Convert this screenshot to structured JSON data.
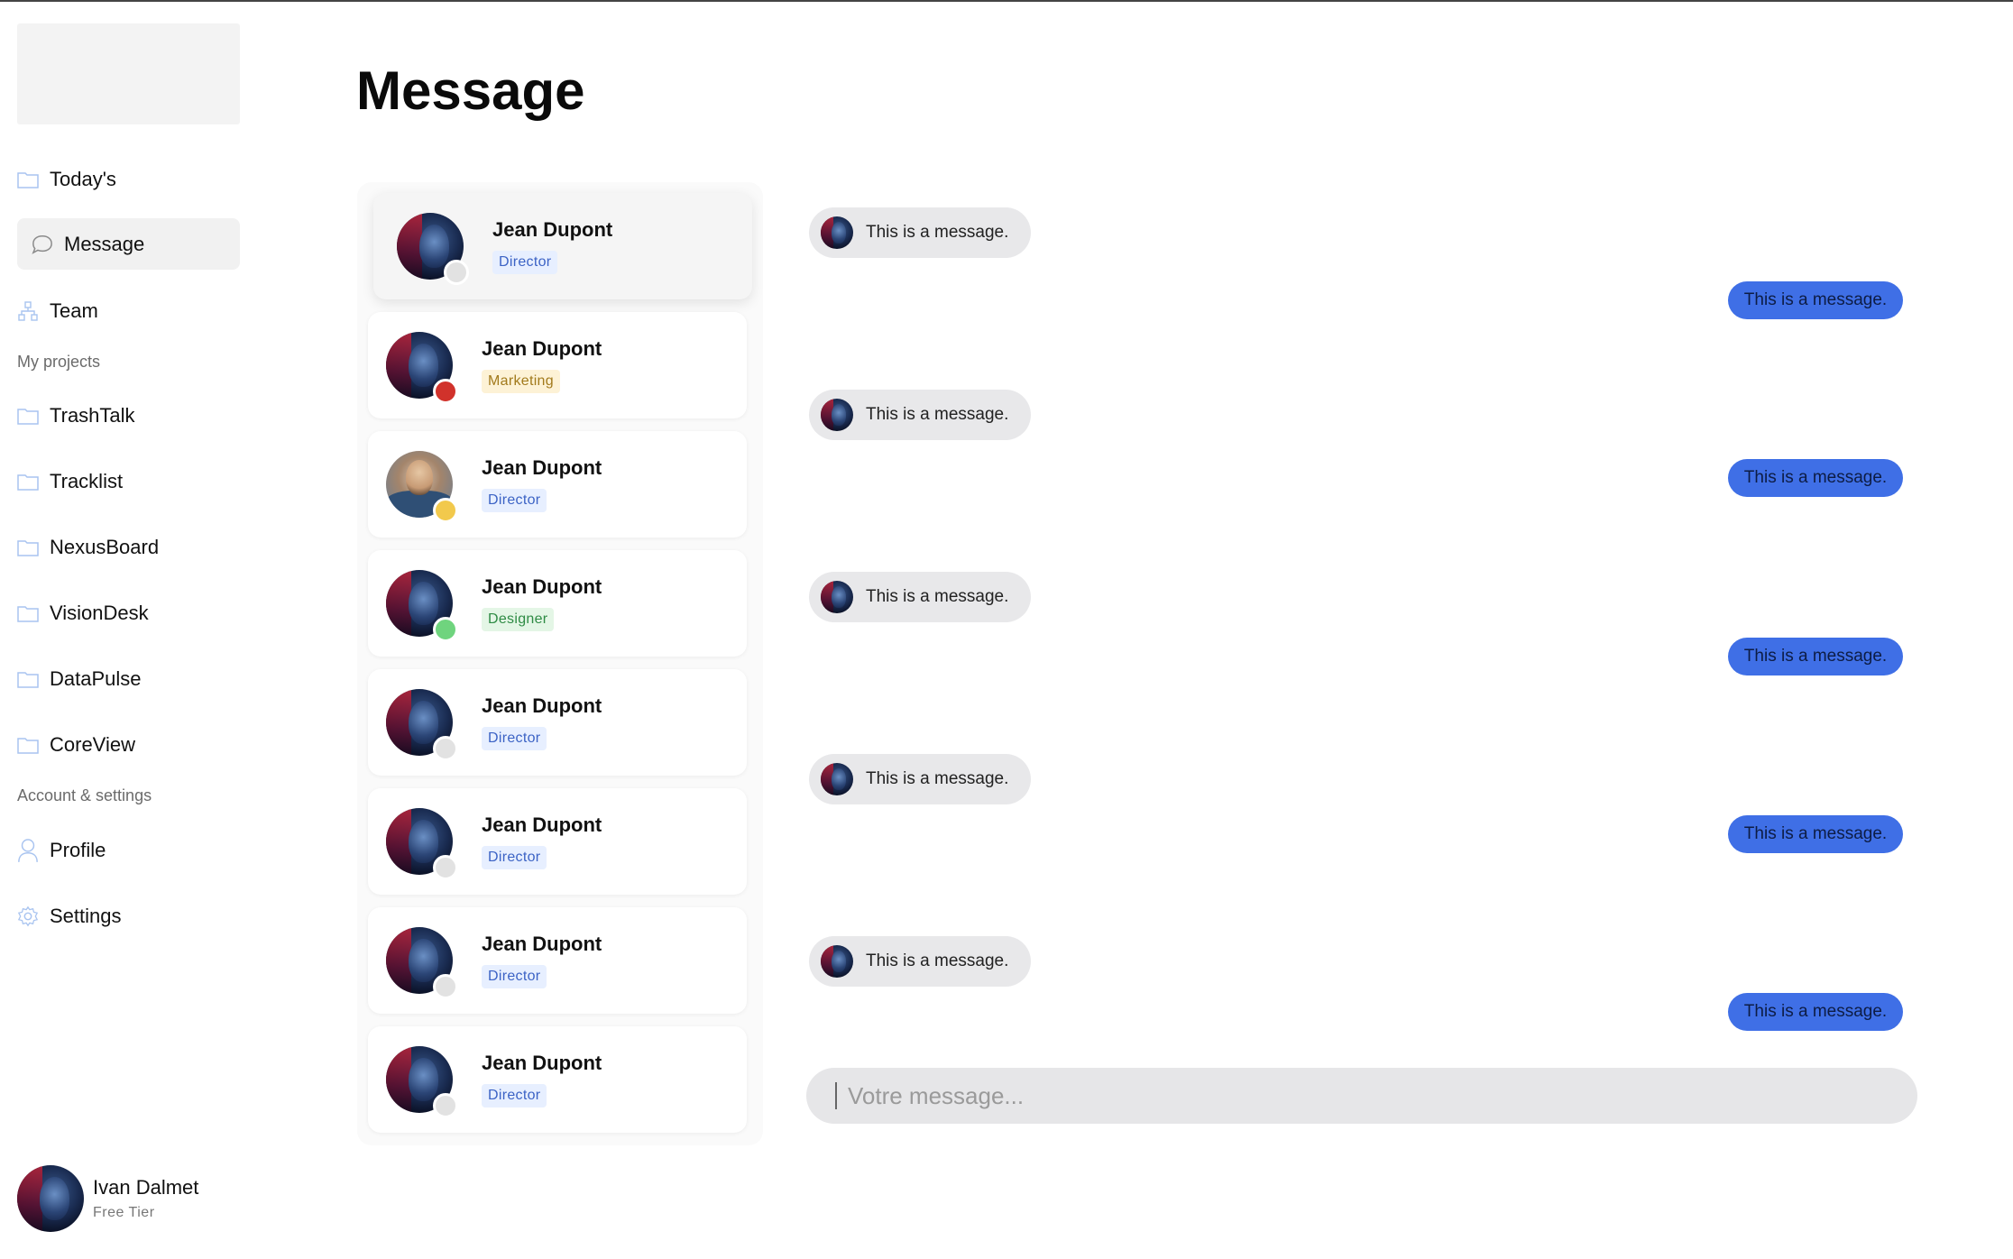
{
  "sidebar": {
    "nav": [
      {
        "label": "Today's",
        "icon": "folder-icon"
      },
      {
        "label": "Message",
        "icon": "chat-bubble-icon",
        "active": true
      },
      {
        "label": "Team",
        "icon": "team-icon"
      }
    ],
    "projects_heading": "My projects",
    "projects": [
      "TrashTalk",
      "Tracklist",
      "NexusBoard",
      "VisionDesk",
      "DataPulse",
      "CoreView"
    ],
    "account_heading": "Account & settings",
    "account": [
      {
        "label": "Profile",
        "icon": "user-icon"
      },
      {
        "label": "Settings",
        "icon": "gear-icon"
      }
    ],
    "user": {
      "name": "Ivan Dalmet",
      "tier": "Free Tier"
    }
  },
  "main": {
    "title": "Message",
    "contacts": [
      {
        "name": "Jean Dupont",
        "role": "Director",
        "status_color": "#e2e2e2",
        "selected": true
      },
      {
        "name": "Jean Dupont",
        "role": "Marketing",
        "status_color": "#d1322b"
      },
      {
        "name": "Jean Dupont",
        "role": "Director",
        "status_color": "#f2c94c",
        "photo": true
      },
      {
        "name": "Jean Dupont",
        "role": "Designer",
        "status_color": "#6fd47e"
      },
      {
        "name": "Jean Dupont",
        "role": "Director",
        "status_color": "#e2e2e2"
      },
      {
        "name": "Jean Dupont",
        "role": "Director",
        "status_color": "#e2e2e2"
      },
      {
        "name": "Jean Dupont",
        "role": "Director",
        "status_color": "#e2e2e2"
      },
      {
        "name": "Jean Dupont",
        "role": "Director",
        "status_color": "#e2e2e2"
      }
    ],
    "messages": [
      {
        "direction": "in",
        "text": "This is a message."
      },
      {
        "direction": "out",
        "text": "This is a message."
      },
      {
        "direction": "in",
        "text": "This is a message."
      },
      {
        "direction": "out",
        "text": "This is a message."
      },
      {
        "direction": "in",
        "text": "This is a message."
      },
      {
        "direction": "out",
        "text": "This is a message."
      },
      {
        "direction": "in",
        "text": "This is a message."
      },
      {
        "direction": "out",
        "text": "This is a message."
      },
      {
        "direction": "in",
        "text": "This is a message."
      },
      {
        "direction": "out",
        "text": "This is a message."
      }
    ],
    "composer_placeholder": "Votre message..."
  },
  "colors": {
    "accent": "#3f6fe6",
    "director_badge": "#e7efff",
    "marketing_badge": "#fdf2d6",
    "designer_badge": "#e4f6e6"
  }
}
